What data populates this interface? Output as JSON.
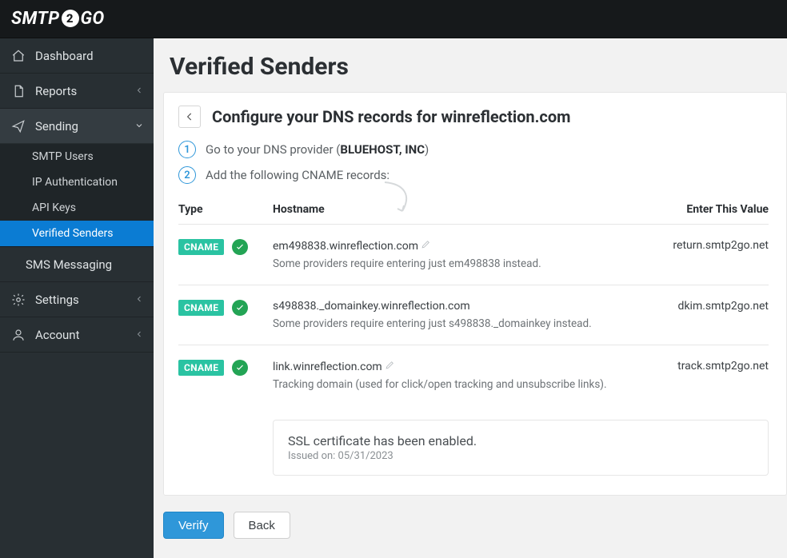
{
  "brand": {
    "left": "SMTP",
    "mid": "2",
    "right": "GO"
  },
  "nav": {
    "dashboard": "Dashboard",
    "reports": "Reports",
    "sending": "Sending",
    "sending_items": {
      "smtp_users": "SMTP Users",
      "ip_auth": "IP Authentication",
      "api_keys": "API Keys",
      "verified_senders": "Verified Senders"
    },
    "sms": "SMS Messaging",
    "settings": "Settings",
    "account": "Account"
  },
  "page": {
    "title": "Verified Senders",
    "panel_title": "Configure your DNS records for winreflection.com",
    "step1_pre": "Go to your DNS provider (",
    "step1_bold": "BLUEHOST, INC",
    "step1_post": ")",
    "step2": "Add the following CNAME records:",
    "cols": {
      "type": "Type",
      "hostname": "Hostname",
      "value": "Enter This Value"
    },
    "cname_label": "CNAME",
    "rows": [
      {
        "hostname": "em498838.winreflection.com",
        "editable": true,
        "note": "Some providers require entering just em498838 instead.",
        "value": "return.smtp2go.net"
      },
      {
        "hostname": "s498838._domainkey.winreflection.com",
        "editable": false,
        "note": "Some providers require entering just s498838._domainkey instead.",
        "value": "dkim.smtp2go.net"
      },
      {
        "hostname": "link.winreflection.com",
        "editable": true,
        "note": "Tracking domain (used for click/open tracking and unsubscribe links).",
        "value": "track.smtp2go.net"
      }
    ],
    "ssl": {
      "title": "SSL certificate has been enabled.",
      "issued": "Issued on: 05/31/2023"
    },
    "buttons": {
      "verify": "Verify",
      "back": "Back"
    }
  }
}
